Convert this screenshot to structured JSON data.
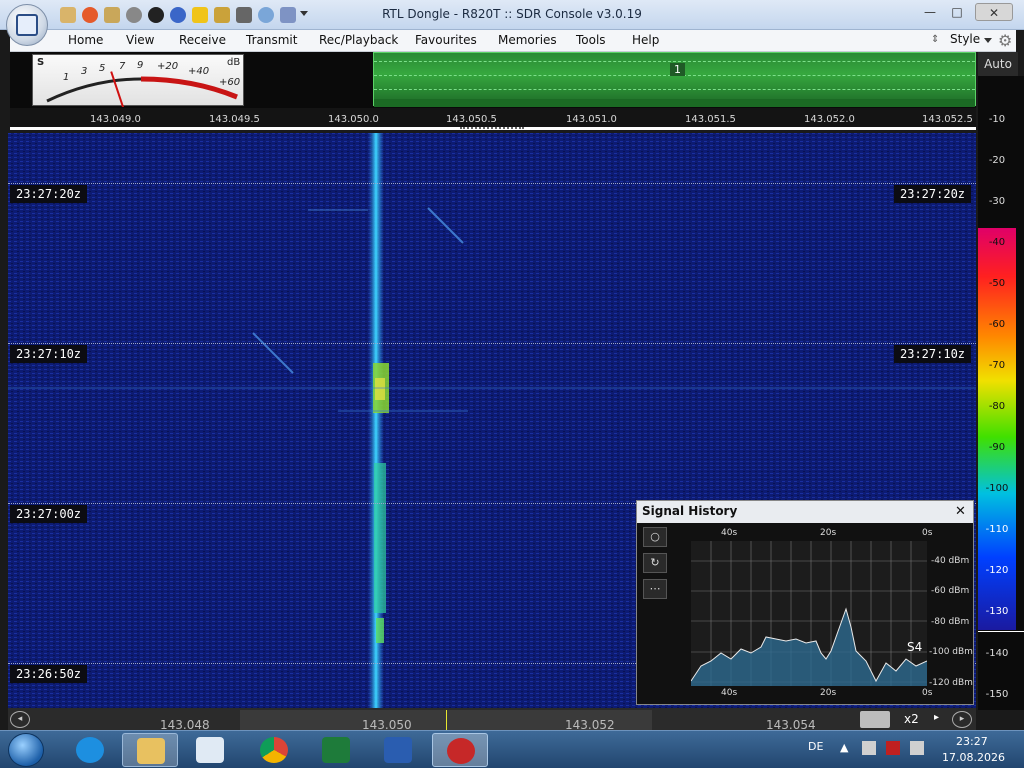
{
  "window": {
    "title": "RTL Dongle - R820T :: SDR Console v3.0.19",
    "minimize_icon": "—",
    "maximize_icon": "□",
    "close_icon": "✕"
  },
  "menu": {
    "items": [
      "Home",
      "View",
      "Receive",
      "Transmit",
      "Rec/Playback",
      "Favourites",
      "Memories",
      "Tools",
      "Help"
    ],
    "style_label": "Style"
  },
  "smeter": {
    "s_label": "S",
    "db_label": "dB",
    "scale": [
      "1",
      "3",
      "5",
      "7",
      "9",
      "+20",
      "+40",
      "+60"
    ],
    "needle_level": 0.34
  },
  "spectrum": {
    "vfo_marker": "1"
  },
  "auto_button": "Auto",
  "freq_axis": [
    "143.049.0",
    "143.049.5",
    "143.050.0",
    "143.050.5",
    "143.051.0",
    "143.051.5",
    "143.052.0",
    "143.052.5"
  ],
  "waterfall": {
    "timestamps": [
      "23:27:20z",
      "23:27:10z",
      "23:27:00z",
      "23:26:50z"
    ]
  },
  "right_scale": [
    "-10",
    "-20",
    "-30",
    "-40",
    "-50",
    "-60",
    "-70",
    "-80",
    "-90",
    "-100",
    "-110",
    "-120",
    "-130",
    "-140",
    "-150"
  ],
  "signal_history": {
    "title": "Signal History",
    "close_icon": "✕",
    "tools": [
      "○",
      "↻",
      "⋯"
    ],
    "x_top": [
      "40s",
      "20s",
      "0s"
    ],
    "x_bottom": [
      "40s",
      "20s",
      "0s"
    ],
    "y_labels": [
      "-40 dBm",
      "-60 dBm",
      "-80 dBm",
      "-100 dBm",
      "-120 dBm"
    ],
    "s_reading": "S4"
  },
  "bottom_freq": [
    "143.048",
    "143.050",
    "143.052",
    "143.054"
  ],
  "zoom_label": "x2",
  "taskbar": {
    "language": "DE",
    "time": "23:27",
    "date": "17.08.2026"
  },
  "colors": {
    "waterfall_bg": "#0c1a6e",
    "signal": "#3dd6ff",
    "spectrum_green": "#36a83f",
    "taskbar": "#2a5282"
  }
}
